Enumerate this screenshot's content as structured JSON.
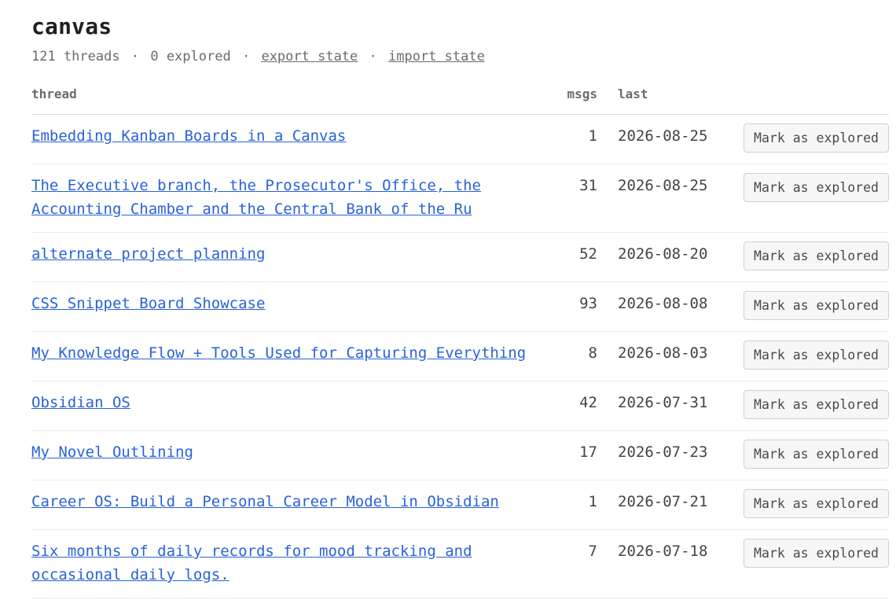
{
  "page": {
    "title": "canvas",
    "threads_count": "121 threads",
    "explored_count": "0 explored",
    "separator": "·",
    "export_label": "export state",
    "import_label": "import state"
  },
  "table": {
    "headers": {
      "thread": "thread",
      "msgs": "msgs",
      "last": "last"
    },
    "rows": [
      {
        "title": "Embedding Kanban Boards in a Canvas",
        "msgs": "1",
        "last": "2026-08-25",
        "action": "Mark as explored"
      },
      {
        "title": "The Executive branch, the Prosecutor's Office, the Accounting Chamber and the Central Bank of the Ru",
        "msgs": "31",
        "last": "2026-08-25",
        "action": "Mark as explored"
      },
      {
        "title": "alternate project planning",
        "msgs": "52",
        "last": "2026-08-20",
        "action": "Mark as explored"
      },
      {
        "title": "CSS Snippet Board Showcase",
        "msgs": "93",
        "last": "2026-08-08",
        "action": "Mark as explored"
      },
      {
        "title": "My Knowledge Flow + Tools Used for Capturing Everything",
        "msgs": "8",
        "last": "2026-08-03",
        "action": "Mark as explored"
      },
      {
        "title": "Obsidian OS",
        "msgs": "42",
        "last": "2026-07-31",
        "action": "Mark as explored"
      },
      {
        "title": "My Novel Outlining",
        "msgs": "17",
        "last": "2026-07-23",
        "action": "Mark as explored"
      },
      {
        "title": "Career OS: Build a Personal Career Model in Obsidian",
        "msgs": "1",
        "last": "2026-07-21",
        "action": "Mark as explored"
      },
      {
        "title": "Six months of daily records for mood tracking and occasional daily logs.",
        "msgs": "7",
        "last": "2026-07-18",
        "action": "Mark as explored"
      }
    ]
  }
}
